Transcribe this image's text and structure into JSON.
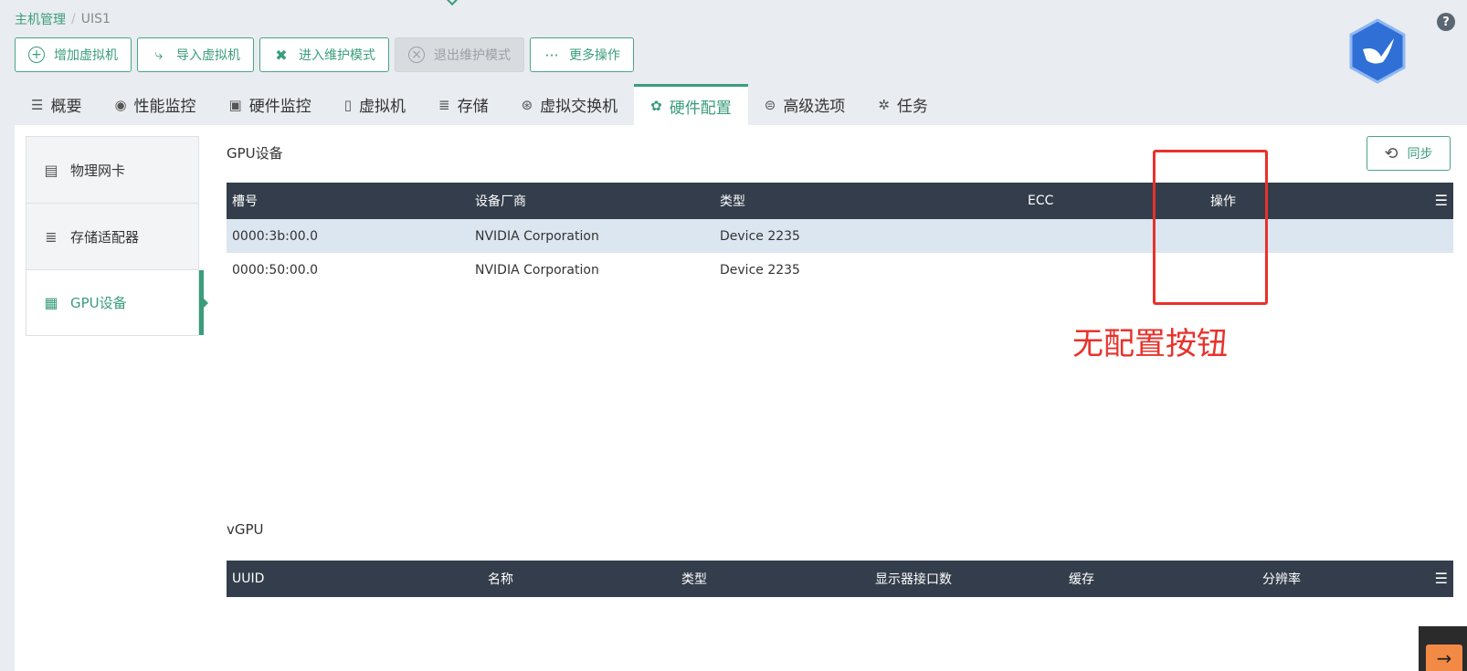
{
  "breadcrumb": {
    "root": "主机管理",
    "separator": "/",
    "current": "UIS1"
  },
  "toolbar": {
    "add_vm": "增加虚拟机",
    "import_vm": "导入虚拟机",
    "enter_maintenance": "进入维护模式",
    "exit_maintenance": "退出维护模式",
    "more_ops": "更多操作"
  },
  "tabs": [
    {
      "label": "概要",
      "icon": "list-icon"
    },
    {
      "label": "性能监控",
      "icon": "monitor-icon"
    },
    {
      "label": "硬件监控",
      "icon": "hardware-icon"
    },
    {
      "label": "虚拟机",
      "icon": "vm-icon"
    },
    {
      "label": "存储",
      "icon": "storage-icon"
    },
    {
      "label": "虚拟交换机",
      "icon": "switch-icon"
    },
    {
      "label": "硬件配置",
      "icon": "gear-icon",
      "active": true
    },
    {
      "label": "高级选项",
      "icon": "advanced-icon"
    },
    {
      "label": "任务",
      "icon": "task-icon"
    }
  ],
  "sidenav": [
    {
      "label": "物理网卡",
      "icon": "nic-icon"
    },
    {
      "label": "存储适配器",
      "icon": "database-icon"
    },
    {
      "label": "GPU设备",
      "icon": "chip-icon",
      "active": true
    }
  ],
  "gpu": {
    "title": "GPU设备",
    "sync_label": "同步",
    "columns": [
      "槽号",
      "设备厂商",
      "类型",
      "ECC",
      "操作"
    ],
    "rows": [
      {
        "slot": "0000:3b:00.0",
        "vendor": "NVIDIA Corporation",
        "type": "Device 2235",
        "ecc": "",
        "ops": ""
      },
      {
        "slot": "0000:50:00.0",
        "vendor": "NVIDIA Corporation",
        "type": "Device 2235",
        "ecc": "",
        "ops": ""
      }
    ]
  },
  "vgpu": {
    "title": "vGPU",
    "columns": [
      "UUID",
      "名称",
      "类型",
      "显示器接口数",
      "缓存",
      "分辨率"
    ]
  },
  "annotation": {
    "text": "无配置按钮",
    "color": "#e8322b"
  },
  "colors": {
    "accent": "#3a9d7a",
    "header": "#333d4b",
    "selected_row": "#dce6f1"
  }
}
